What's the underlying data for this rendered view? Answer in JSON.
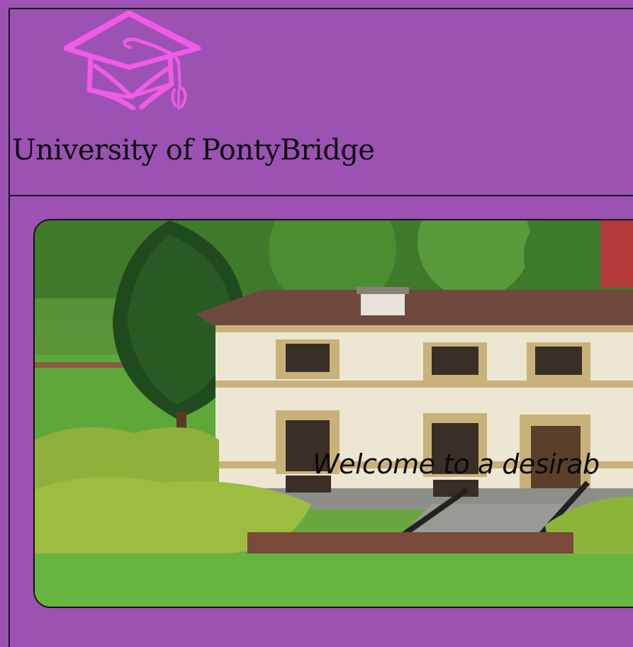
{
  "header": {
    "logo_icon": "graduation-cap-icon",
    "title": "University of PontyBridge"
  },
  "hero": {
    "image_alt": "model-building-photo",
    "caption": "Welcome to a desirab"
  },
  "colors": {
    "background": "#9b52b3",
    "logo": "#f25ae8",
    "border": "#111111"
  }
}
